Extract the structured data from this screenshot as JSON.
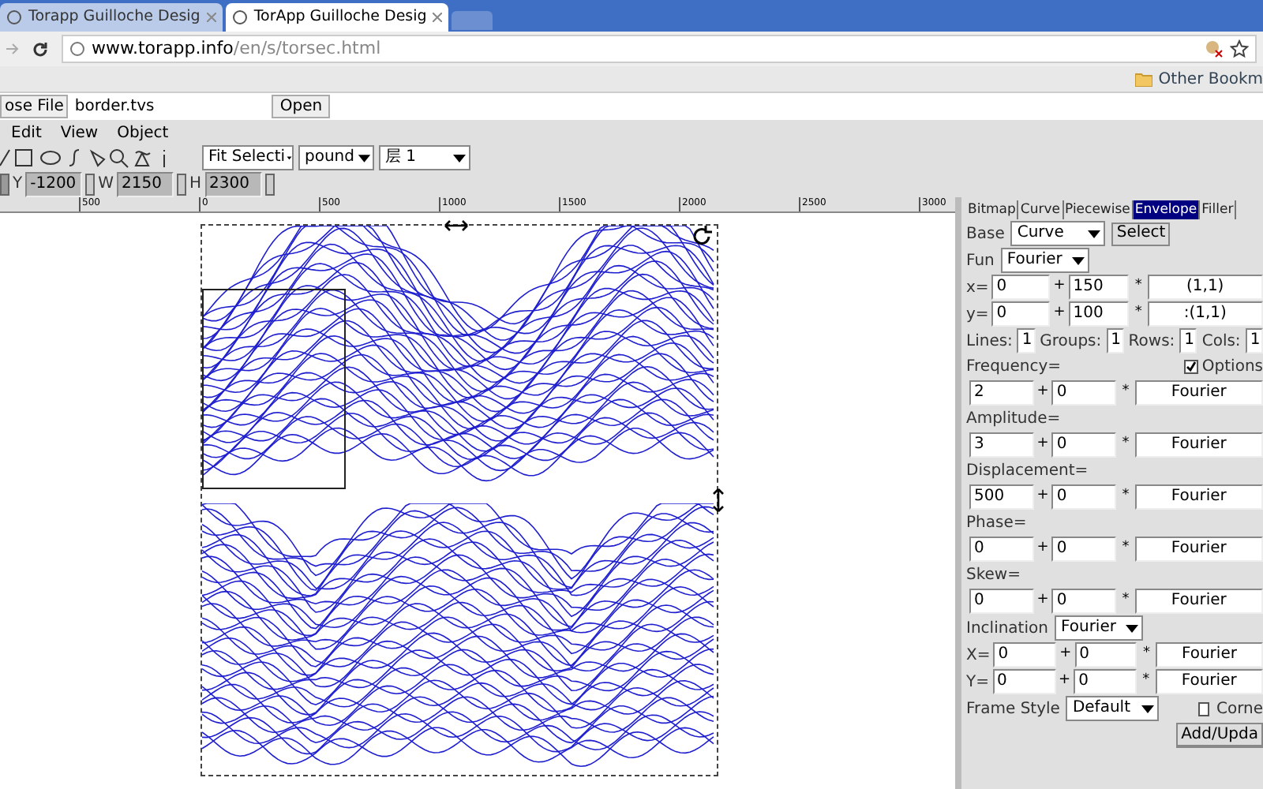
{
  "browser": {
    "tabs": [
      {
        "title": "Torapp Guilloche Desig",
        "selected": false
      },
      {
        "title": "TorApp Guilloche Desig",
        "selected": true
      }
    ],
    "url_host": "www.torapp.info",
    "url_path": "/en/s/torsec.html",
    "bookmark": "Other Bookm"
  },
  "file_row": {
    "button": "ose File",
    "file": "border.tvs",
    "open": "Open"
  },
  "menu": [
    "Edit",
    "View",
    "Object"
  ],
  "toolbar": {
    "zoom": "Fit Selecti",
    "unit": "pound",
    "layer": "层 1"
  },
  "coords": [
    {
      "label": "Y",
      "value": "-1200"
    },
    {
      "label": "W",
      "value": "2150"
    },
    {
      "label": "H",
      "value": "2300"
    }
  ],
  "ruler": [
    "500",
    "0",
    "500",
    "1000",
    "1500",
    "2000",
    "2500",
    "3000"
  ],
  "panel": {
    "tabs": [
      {
        "label": "Bitmap",
        "selected": false
      },
      {
        "label": "Curve",
        "selected": false
      },
      {
        "label": "Piecewise",
        "selected": false
      },
      {
        "label": "Envelope",
        "selected": true
      },
      {
        "label": "Filler",
        "selected": false
      }
    ],
    "plus": "+",
    "times": "*",
    "base_label": "Base",
    "base": "Curve",
    "select": "Select",
    "fun_label": "Fun",
    "fun": "Fourier",
    "xy": [
      {
        "label": "x=",
        "a": "0",
        "b": "150",
        "c": "(1,1)"
      },
      {
        "label": "y=",
        "a": "0",
        "b": "100",
        "c": ":(1,1)"
      }
    ],
    "counts": [
      {
        "label": "Lines:",
        "value": "1"
      },
      {
        "label": "Groups:",
        "value": "1"
      },
      {
        "label": "Rows:",
        "value": "1"
      },
      {
        "label": "Cols:",
        "value": "1"
      }
    ],
    "options": {
      "label": "Options",
      "checked": true
    },
    "params": [
      {
        "label": "Frequency=",
        "a": "2",
        "b": "0",
        "c": "Fourier"
      },
      {
        "label": "Amplitude=",
        "a": "3",
        "b": "0",
        "c": "Fourier"
      },
      {
        "label": "Displacement=",
        "a": "500",
        "b": "0",
        "c": "Fourier"
      },
      {
        "label": "Phase=",
        "a": "0",
        "b": "0",
        "c": "Fourier"
      },
      {
        "label": "Skew=",
        "a": "0",
        "b": "0",
        "c": "Fourier"
      }
    ],
    "inclination_label": "Inclination",
    "inclination": "Fourier",
    "incl_xy": [
      {
        "label": "X=",
        "a": "0",
        "b": "0",
        "c": "Fourier"
      },
      {
        "label": "Y=",
        "a": "0",
        "b": "0",
        "c": "Fourier"
      }
    ],
    "frame_label": "Frame Style",
    "frame": "Default",
    "corner": {
      "label": "Corne",
      "checked": false
    },
    "add": "Add/Upda"
  }
}
